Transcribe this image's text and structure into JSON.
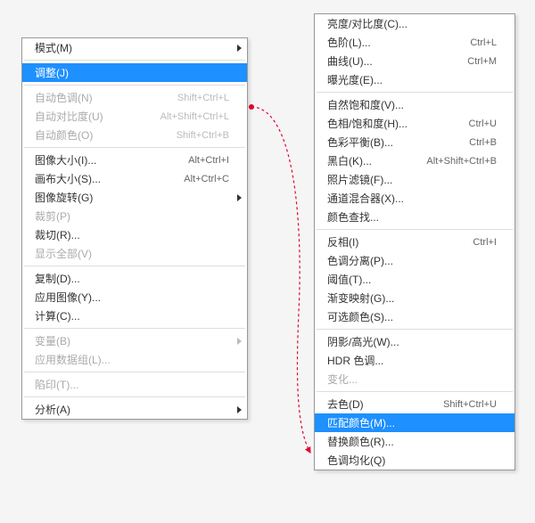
{
  "left_menu": {
    "groups": [
      [
        {
          "label": "模式(M)",
          "shortcut": "",
          "submenu": true,
          "disabled": false,
          "selected": false,
          "name": "mode"
        }
      ],
      [
        {
          "label": "调整(J)",
          "shortcut": "",
          "submenu": false,
          "disabled": false,
          "selected": true,
          "name": "adjustments"
        }
      ],
      [
        {
          "label": "自动色调(N)",
          "shortcut": "Shift+Ctrl+L",
          "submenu": false,
          "disabled": true,
          "selected": false,
          "name": "auto-tone"
        },
        {
          "label": "自动对比度(U)",
          "shortcut": "Alt+Shift+Ctrl+L",
          "submenu": false,
          "disabled": true,
          "selected": false,
          "name": "auto-contrast"
        },
        {
          "label": "自动颜色(O)",
          "shortcut": "Shift+Ctrl+B",
          "submenu": false,
          "disabled": true,
          "selected": false,
          "name": "auto-color"
        }
      ],
      [
        {
          "label": "图像大小(I)...",
          "shortcut": "Alt+Ctrl+I",
          "submenu": false,
          "disabled": false,
          "selected": false,
          "name": "image-size"
        },
        {
          "label": "画布大小(S)...",
          "shortcut": "Alt+Ctrl+C",
          "submenu": false,
          "disabled": false,
          "selected": false,
          "name": "canvas-size"
        },
        {
          "label": "图像旋转(G)",
          "shortcut": "",
          "submenu": true,
          "disabled": false,
          "selected": false,
          "name": "image-rotation"
        },
        {
          "label": "裁剪(P)",
          "shortcut": "",
          "submenu": false,
          "disabled": true,
          "selected": false,
          "name": "crop"
        },
        {
          "label": "裁切(R)...",
          "shortcut": "",
          "submenu": false,
          "disabled": false,
          "selected": false,
          "name": "trim"
        },
        {
          "label": "显示全部(V)",
          "shortcut": "",
          "submenu": false,
          "disabled": true,
          "selected": false,
          "name": "reveal-all"
        }
      ],
      [
        {
          "label": "复制(D)...",
          "shortcut": "",
          "submenu": false,
          "disabled": false,
          "selected": false,
          "name": "duplicate"
        },
        {
          "label": "应用图像(Y)...",
          "shortcut": "",
          "submenu": false,
          "disabled": false,
          "selected": false,
          "name": "apply-image"
        },
        {
          "label": "计算(C)...",
          "shortcut": "",
          "submenu": false,
          "disabled": false,
          "selected": false,
          "name": "calculations"
        }
      ],
      [
        {
          "label": "变量(B)",
          "shortcut": "",
          "submenu": true,
          "disabled": true,
          "selected": false,
          "name": "variables"
        },
        {
          "label": "应用数据组(L)...",
          "shortcut": "",
          "submenu": false,
          "disabled": true,
          "selected": false,
          "name": "apply-data-set"
        }
      ],
      [
        {
          "label": "陷印(T)...",
          "shortcut": "",
          "submenu": false,
          "disabled": true,
          "selected": false,
          "name": "trap"
        }
      ],
      [
        {
          "label": "分析(A)",
          "shortcut": "",
          "submenu": true,
          "disabled": false,
          "selected": false,
          "name": "analysis"
        }
      ]
    ]
  },
  "right_menu": {
    "groups": [
      [
        {
          "label": "亮度/对比度(C)...",
          "shortcut": "",
          "submenu": false,
          "disabled": false,
          "selected": false,
          "name": "brightness-contrast"
        },
        {
          "label": "色阶(L)...",
          "shortcut": "Ctrl+L",
          "submenu": false,
          "disabled": false,
          "selected": false,
          "name": "levels"
        },
        {
          "label": "曲线(U)...",
          "shortcut": "Ctrl+M",
          "submenu": false,
          "disabled": false,
          "selected": false,
          "name": "curves"
        },
        {
          "label": "曝光度(E)...",
          "shortcut": "",
          "submenu": false,
          "disabled": false,
          "selected": false,
          "name": "exposure"
        }
      ],
      [
        {
          "label": "自然饱和度(V)...",
          "shortcut": "",
          "submenu": false,
          "disabled": false,
          "selected": false,
          "name": "vibrance"
        },
        {
          "label": "色相/饱和度(H)...",
          "shortcut": "Ctrl+U",
          "submenu": false,
          "disabled": false,
          "selected": false,
          "name": "hue-saturation"
        },
        {
          "label": "色彩平衡(B)...",
          "shortcut": "Ctrl+B",
          "submenu": false,
          "disabled": false,
          "selected": false,
          "name": "color-balance"
        },
        {
          "label": "黑白(K)...",
          "shortcut": "Alt+Shift+Ctrl+B",
          "submenu": false,
          "disabled": false,
          "selected": false,
          "name": "black-white"
        },
        {
          "label": "照片滤镜(F)...",
          "shortcut": "",
          "submenu": false,
          "disabled": false,
          "selected": false,
          "name": "photo-filter"
        },
        {
          "label": "通道混合器(X)...",
          "shortcut": "",
          "submenu": false,
          "disabled": false,
          "selected": false,
          "name": "channel-mixer"
        },
        {
          "label": "颜色查找...",
          "shortcut": "",
          "submenu": false,
          "disabled": false,
          "selected": false,
          "name": "color-lookup"
        }
      ],
      [
        {
          "label": "反相(I)",
          "shortcut": "Ctrl+I",
          "submenu": false,
          "disabled": false,
          "selected": false,
          "name": "invert"
        },
        {
          "label": "色调分离(P)...",
          "shortcut": "",
          "submenu": false,
          "disabled": false,
          "selected": false,
          "name": "posterize"
        },
        {
          "label": "阈值(T)...",
          "shortcut": "",
          "submenu": false,
          "disabled": false,
          "selected": false,
          "name": "threshold"
        },
        {
          "label": "渐变映射(G)...",
          "shortcut": "",
          "submenu": false,
          "disabled": false,
          "selected": false,
          "name": "gradient-map"
        },
        {
          "label": "可选颜色(S)...",
          "shortcut": "",
          "submenu": false,
          "disabled": false,
          "selected": false,
          "name": "selective-color"
        }
      ],
      [
        {
          "label": "阴影/高光(W)...",
          "shortcut": "",
          "submenu": false,
          "disabled": false,
          "selected": false,
          "name": "shadows-highlights"
        },
        {
          "label": "HDR 色调...",
          "shortcut": "",
          "submenu": false,
          "disabled": false,
          "selected": false,
          "name": "hdr-toning"
        },
        {
          "label": "变化...",
          "shortcut": "",
          "submenu": false,
          "disabled": true,
          "selected": false,
          "name": "variations"
        }
      ],
      [
        {
          "label": "去色(D)",
          "shortcut": "Shift+Ctrl+U",
          "submenu": false,
          "disabled": false,
          "selected": false,
          "name": "desaturate"
        },
        {
          "label": "匹配颜色(M)...",
          "shortcut": "",
          "submenu": false,
          "disabled": false,
          "selected": true,
          "name": "match-color"
        },
        {
          "label": "替换颜色(R)...",
          "shortcut": "",
          "submenu": false,
          "disabled": false,
          "selected": false,
          "name": "replace-color"
        },
        {
          "label": "色调均化(Q)",
          "shortcut": "",
          "submenu": false,
          "disabled": false,
          "selected": false,
          "name": "equalize"
        }
      ]
    ]
  },
  "connector": {
    "color": "#e6002d"
  }
}
